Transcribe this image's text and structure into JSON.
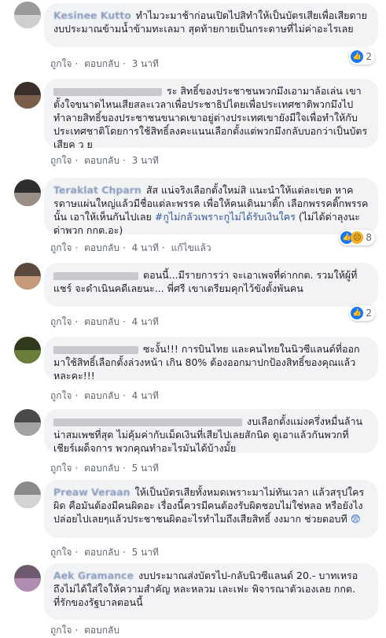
{
  "comments": [
    {
      "author": "Kesinee Kutto",
      "text": "ทำไมวะมาช้าก่อนเปิดไปสิทำให้เป็นบัตรเสียเพื่อเสียดายงบประมาณข้ามน้ำข้ามทะเลมา สุดท้ายกายเป็นกระดาษที่ไม่ค่าอะไรเลย",
      "like": "ถูกใจ",
      "reply": "ตอบกลับ",
      "time": "3 นาที",
      "reactions": "2"
    },
    {
      "author": "",
      "text": "ระ สิทธิ์ของประชาชนพวกมึงเอามาล้อเล่น เขาตั้งใจขนาดไหนเสียสละเวลาเพื่อประชาธิปไตยเพื่อประเทศชาติพวกมึงไปทำลายสิทธิ์ของประชาชนขนาดเขาอยู่ต่างประเทศเขายังมีใจเพื่อทำให้กับประเทศชาติโดยการใช้สิทธิ์ลงคะแนนเลือกตั้งแต่พวกมึงกลับบอกว่าเป็นบัตรเสียค ว ย",
      "like": "ถูกใจ",
      "reply": "ตอบกลับ",
      "time": "3 นาที"
    },
    {
      "author": "Teraklat Chparn",
      "text": "สัส แน่จริงเลือกตั้งใหม่สิ แนะนำให้แต่ละเขต หาครดาษแผ่นใหญ่แล้วมีชื่อแต่ละพรรค เพื่อให้คนเดินมาติ๊ก เลือกพรรคติ๊กพรรคนั้น เอาให้เห็นกันไปเลย",
      "hashtag": "#กูไม่กลัวเพราะกูไม่ได้รับเงินใคร",
      "tail": "(ไม่ได้ด่าลุงนะ ด่าพวก กกต.อะ)",
      "like": "ถูกใจ",
      "reply": "ตอบกลับ",
      "time": "4 นาที",
      "edited": "แก้ไขแล้ว",
      "reactions": "8"
    },
    {
      "author": "",
      "text": "ตอนนี้...มีรายการว่า จะเอาเพจที่ด่ากกต. รวมให้ผู้ที่แชร์ จะดำเนินคดีเลยนะ... พี่ศรี เขาเตรียมคุกไว้ขังตั้งพันคน",
      "like": "ถูกใจ",
      "reply": "ตอบกลับ",
      "time": "4 นาที",
      "reactions": "2"
    },
    {
      "author": "",
      "text": "ซะงั้น!!! การบินไทย และคนไทยในนิวซีแลนด์ที่ออกมาใช้สิทธิ์เลือกตั้งล่วงหน้า เกิน 80% ต้องออกมาปกป้องสิทธิ์ของคุณแล้วหละคะ!!!",
      "like": "ถูกใจ",
      "reply": "ตอบกลับ",
      "time": "4 นาที"
    },
    {
      "author": "",
      "text": "งบเลือกตั้งแม่งครึ่งหมื่นล้าน น่าสมเพชที่สุด ไม่คุ้มค่ากับเม็ดเงินที่เสียไปเลยสักนิด ดูเอาแล้วกันพวกที่เชียร์เผด็จการ พวกคุณทำอะไรมันได้บ้างมั้ย",
      "like": "ถูกใจ",
      "reply": "ตอบกลับ",
      "time": "5 นาที"
    },
    {
      "author": "Preaw Veraan",
      "text": "ให้เป็นบัตรเสียทั้งหมดเพราะมาไม่ทันเวลา แล้วสรุปใครผิด คือมันต้องมีคนผิดอะ เรื่องนี้ควรมีคนต้องรับผิดชอบไม่ใช่หลอ หรือยังไงปล่อยไปเลยๆแล้วประชาชนผิดอะไรทำไมถึงเสียสิทธิ์ งงมาก ช่วยตอบที",
      "emoji": "😨",
      "like": "ถูกใจ",
      "reply": "ตอบกลับ",
      "time": "5 นาที"
    },
    {
      "author": "Aek Gramance",
      "text": "งบประมาณส่งบัตรไป-กลับนิวซีแลนด์ 20.- บาทเหรอ ถึงไม่ได้ใส่ใจให้ความสำคัญ หละหลวม เละเฟะ พิจารณาตัวเองเลย กกต. ที่รักของรัฐบาลตอนนี้",
      "like": "ถูกใจ",
      "reply": "ตอบกลับ"
    }
  ]
}
